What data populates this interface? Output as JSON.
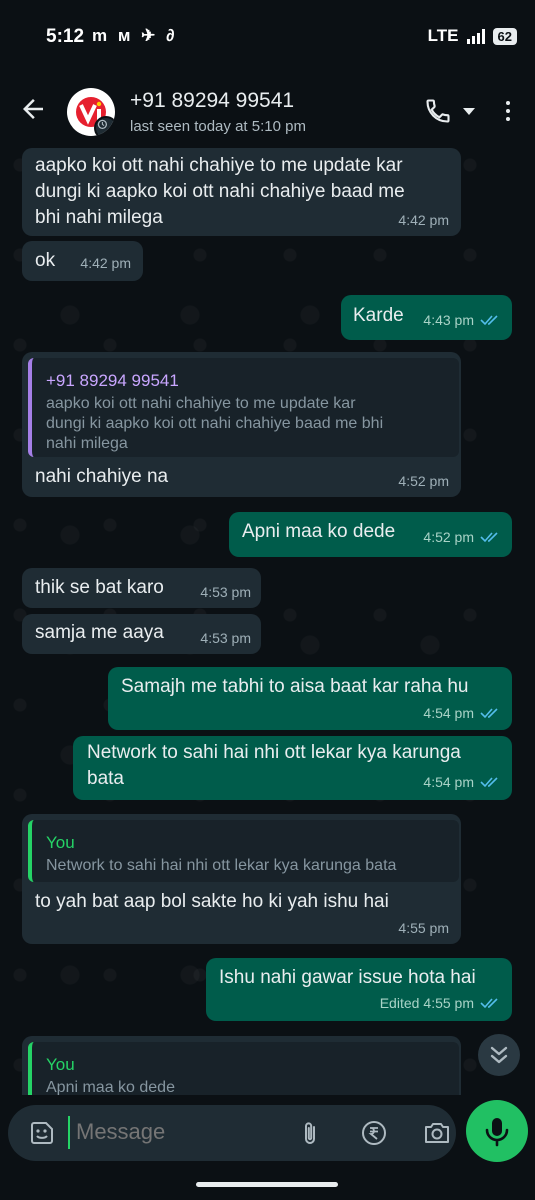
{
  "status_bar": {
    "time": "5:12",
    "notif_icons": "m м ✈ ∂",
    "network": "LTE",
    "battery": "62"
  },
  "header": {
    "contact_name": "+91 89294 99541",
    "last_seen": "last seen today at 5:10 pm",
    "avatar_logo": "Vi"
  },
  "messages": [
    {
      "dir": "in",
      "text": "aapko koi ott nahi chahiye to me update kar\ndungi ki aapko koi ott nahi chahiye baad me\nbhi nahi milega",
      "time": "4:42 pm"
    },
    {
      "dir": "in",
      "text": "ok",
      "time": "4:42 pm"
    },
    {
      "dir": "out",
      "text": "Karde",
      "time": "4:43 pm"
    },
    {
      "dir": "in",
      "quote_author": "+91 89294 99541",
      "quote_text": "aapko koi ott nahi chahiye to me update kar\ndungi ki aapko koi ott nahi chahiye baad me bhi\nnahi milega",
      "text": "nahi chahiye na",
      "time": "4:52 pm"
    },
    {
      "dir": "out",
      "text": "Apni maa ko dede",
      "time": "4:52 pm"
    },
    {
      "dir": "in",
      "text": "thik se bat karo",
      "time": "4:53 pm"
    },
    {
      "dir": "in",
      "text": "samja me aaya",
      "time": "4:53 pm"
    },
    {
      "dir": "out",
      "text": "Samajh me tabhi to aisa baat kar raha hu",
      "time": "4:54 pm"
    },
    {
      "dir": "out",
      "text": "Network to sahi hai nhi ott lekar kya karunga\nbata",
      "time": "4:54 pm"
    },
    {
      "dir": "in",
      "quote_author": "You",
      "quote_text": "Network to sahi hai nhi ott lekar kya karunga bata",
      "text": "to yah bat aap bol sakte ho ki yah ishu hai",
      "time": "4:55 pm"
    },
    {
      "dir": "out",
      "text": "Ishu nahi gawar issue hota hai",
      "edited": "Edited",
      "time": "4:55 pm"
    },
    {
      "dir": "in",
      "quote_author": "You",
      "quote_text": "Apni maa ko dede"
    }
  ],
  "composer": {
    "placeholder": "Message"
  }
}
